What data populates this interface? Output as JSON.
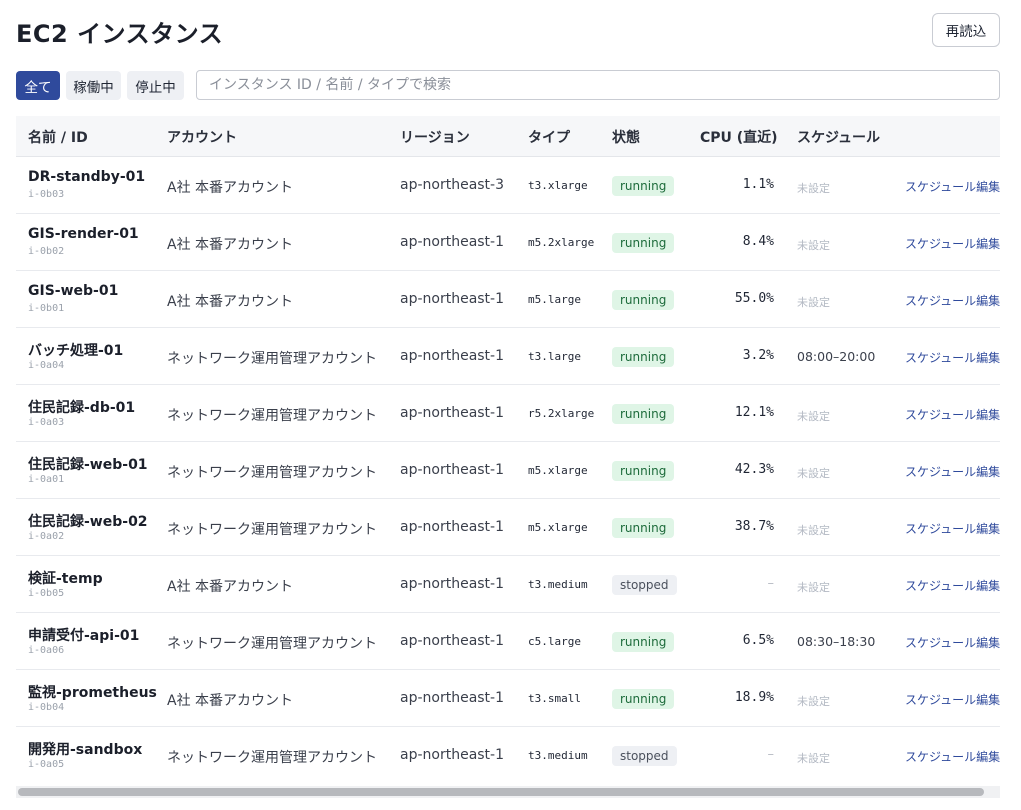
{
  "header": {
    "title": "EC2 インスタンス",
    "reload_label": "再読込"
  },
  "filters": {
    "all": "全て",
    "running": "稼働中",
    "stopped": "停止中",
    "active": "all"
  },
  "search": {
    "placeholder": "インスタンス ID / 名前 / タイプで検索",
    "value": ""
  },
  "table": {
    "columns": {
      "name": "名前 / ID",
      "account": "アカウント",
      "region": "リージョン",
      "type": "タイプ",
      "state": "状態",
      "cpu": "CPU (直近)",
      "schedule": "スケジュール"
    },
    "rows": [
      {
        "name": "DR-standby-01",
        "id": "i-0b03",
        "account": "A社 本番アカウント",
        "region": "ap-northeast-3",
        "type": "t3.xlarge",
        "state": "running",
        "cpu": "1.1%",
        "schedule": "未設定",
        "action": "スケジュール編集"
      },
      {
        "name": "GIS-render-01",
        "id": "i-0b02",
        "account": "A社 本番アカウント",
        "region": "ap-northeast-1",
        "type": "m5.2xlarge",
        "state": "running",
        "cpu": "8.4%",
        "schedule": "未設定",
        "action": "スケジュール編集"
      },
      {
        "name": "GIS-web-01",
        "id": "i-0b01",
        "account": "A社 本番アカウント",
        "region": "ap-northeast-1",
        "type": "m5.large",
        "state": "running",
        "cpu": "55.0%",
        "schedule": "未設定",
        "action": "スケジュール編集"
      },
      {
        "name": "バッチ処理-01",
        "id": "i-0a04",
        "account": "ネットワーク運用管理アカウント",
        "region": "ap-northeast-1",
        "type": "t3.large",
        "state": "running",
        "cpu": "3.2%",
        "schedule": "08:00–20:00",
        "action": "スケジュール編集"
      },
      {
        "name": "住民記録-db-01",
        "id": "i-0a03",
        "account": "ネットワーク運用管理アカウント",
        "region": "ap-northeast-1",
        "type": "r5.2xlarge",
        "state": "running",
        "cpu": "12.1%",
        "schedule": "未設定",
        "action": "スケジュール編集"
      },
      {
        "name": "住民記録-web-01",
        "id": "i-0a01",
        "account": "ネットワーク運用管理アカウント",
        "region": "ap-northeast-1",
        "type": "m5.xlarge",
        "state": "running",
        "cpu": "42.3%",
        "schedule": "未設定",
        "action": "スケジュール編集"
      },
      {
        "name": "住民記録-web-02",
        "id": "i-0a02",
        "account": "ネットワーク運用管理アカウント",
        "region": "ap-northeast-1",
        "type": "m5.xlarge",
        "state": "running",
        "cpu": "38.7%",
        "schedule": "未設定",
        "action": "スケジュール編集"
      },
      {
        "name": "検証-temp",
        "id": "i-0b05",
        "account": "A社 本番アカウント",
        "region": "ap-northeast-1",
        "type": "t3.medium",
        "state": "stopped",
        "cpu": "–",
        "schedule": "未設定",
        "action": "スケジュール編集"
      },
      {
        "name": "申請受付-api-01",
        "id": "i-0a06",
        "account": "ネットワーク運用管理アカウント",
        "region": "ap-northeast-1",
        "type": "c5.large",
        "state": "running",
        "cpu": "6.5%",
        "schedule": "08:30–18:30",
        "action": "スケジュール編集"
      },
      {
        "name": "監視-prometheus",
        "id": "i-0b04",
        "account": "A社 本番アカウント",
        "region": "ap-northeast-1",
        "type": "t3.small",
        "state": "running",
        "cpu": "18.9%",
        "schedule": "未設定",
        "action": "スケジュール編集"
      },
      {
        "name": "開発用-sandbox",
        "id": "i-0a05",
        "account": "ネットワーク運用管理アカウント",
        "region": "ap-northeast-1",
        "type": "t3.medium",
        "state": "stopped",
        "cpu": "–",
        "schedule": "未設定",
        "action": "スケジュール編集"
      }
    ]
  },
  "colors": {
    "accent": "#2f4a9c",
    "running_bg": "#dff5e6",
    "running_text": "#1d6b3b",
    "stopped_bg": "#eef0f4"
  }
}
